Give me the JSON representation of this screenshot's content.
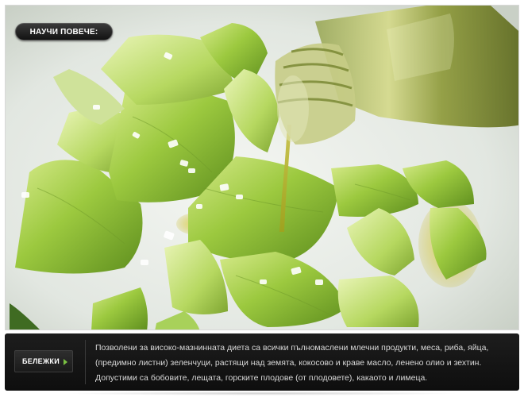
{
  "hero": {
    "image_alt": "Leeks and garlic with olive oil being poured from a bottle",
    "more_button_label": "НАУЧИ ПОВЕЧЕ:"
  },
  "caption": {
    "notes_label": "БЕЛЕЖКИ",
    "notes_icon": "play-arrow-icon",
    "text": "Позволени за високо-мазнинната диета са всички пълномаслени млечни продукти, меса, риба, яйца, (предимно листни) зеленчуци, растящи над земята, кокосово и краве масло, ленено олио и зехтин. Допустими са бобовите, лещата, горските плодове (от плодовете), какаото и лимеца."
  },
  "colors": {
    "panel_bg": "#141414",
    "accent_green": "#7ac142",
    "caption_text": "#d8d8d8"
  }
}
